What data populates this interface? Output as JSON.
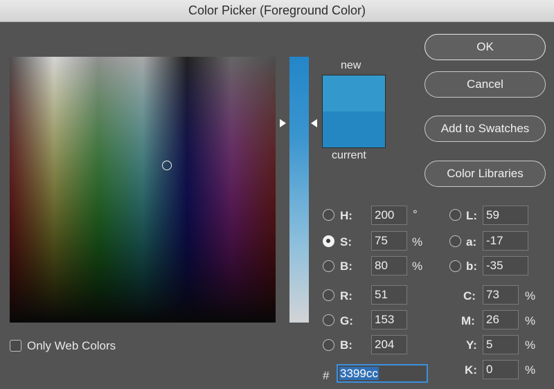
{
  "window": {
    "title": "Color Picker (Foreground Color)"
  },
  "colors": {
    "new": "#3399cc",
    "current": "#2587c2",
    "hue_pure": "#00aaff"
  },
  "swatch": {
    "new_label": "new",
    "current_label": "current"
  },
  "buttons": {
    "ok": "OK",
    "cancel": "Cancel",
    "add_swatches": "Add to Swatches",
    "color_libraries": "Color Libraries"
  },
  "only_web": {
    "label": "Only Web Colors",
    "checked": false
  },
  "hsb": {
    "h": {
      "label": "H:",
      "value": "200",
      "unit": "°"
    },
    "s": {
      "label": "S:",
      "value": "75",
      "unit": "%",
      "selected": true
    },
    "b": {
      "label": "B:",
      "value": "80",
      "unit": "%"
    }
  },
  "rgb": {
    "r": {
      "label": "R:",
      "value": "51"
    },
    "g": {
      "label": "G:",
      "value": "153"
    },
    "b": {
      "label": "B:",
      "value": "204"
    }
  },
  "lab": {
    "l": {
      "label": "L:",
      "value": "59"
    },
    "a": {
      "label": "a:",
      "value": "-17"
    },
    "b": {
      "label": "b:",
      "value": "-35"
    }
  },
  "cmyk": {
    "c": {
      "label": "C:",
      "value": "73",
      "unit": "%"
    },
    "m": {
      "label": "M:",
      "value": "26",
      "unit": "%"
    },
    "y": {
      "label": "Y:",
      "value": "5",
      "unit": "%"
    },
    "k": {
      "label": "K:",
      "value": "0",
      "unit": "%"
    }
  },
  "hex": {
    "label": "#",
    "value": "3399cc"
  }
}
